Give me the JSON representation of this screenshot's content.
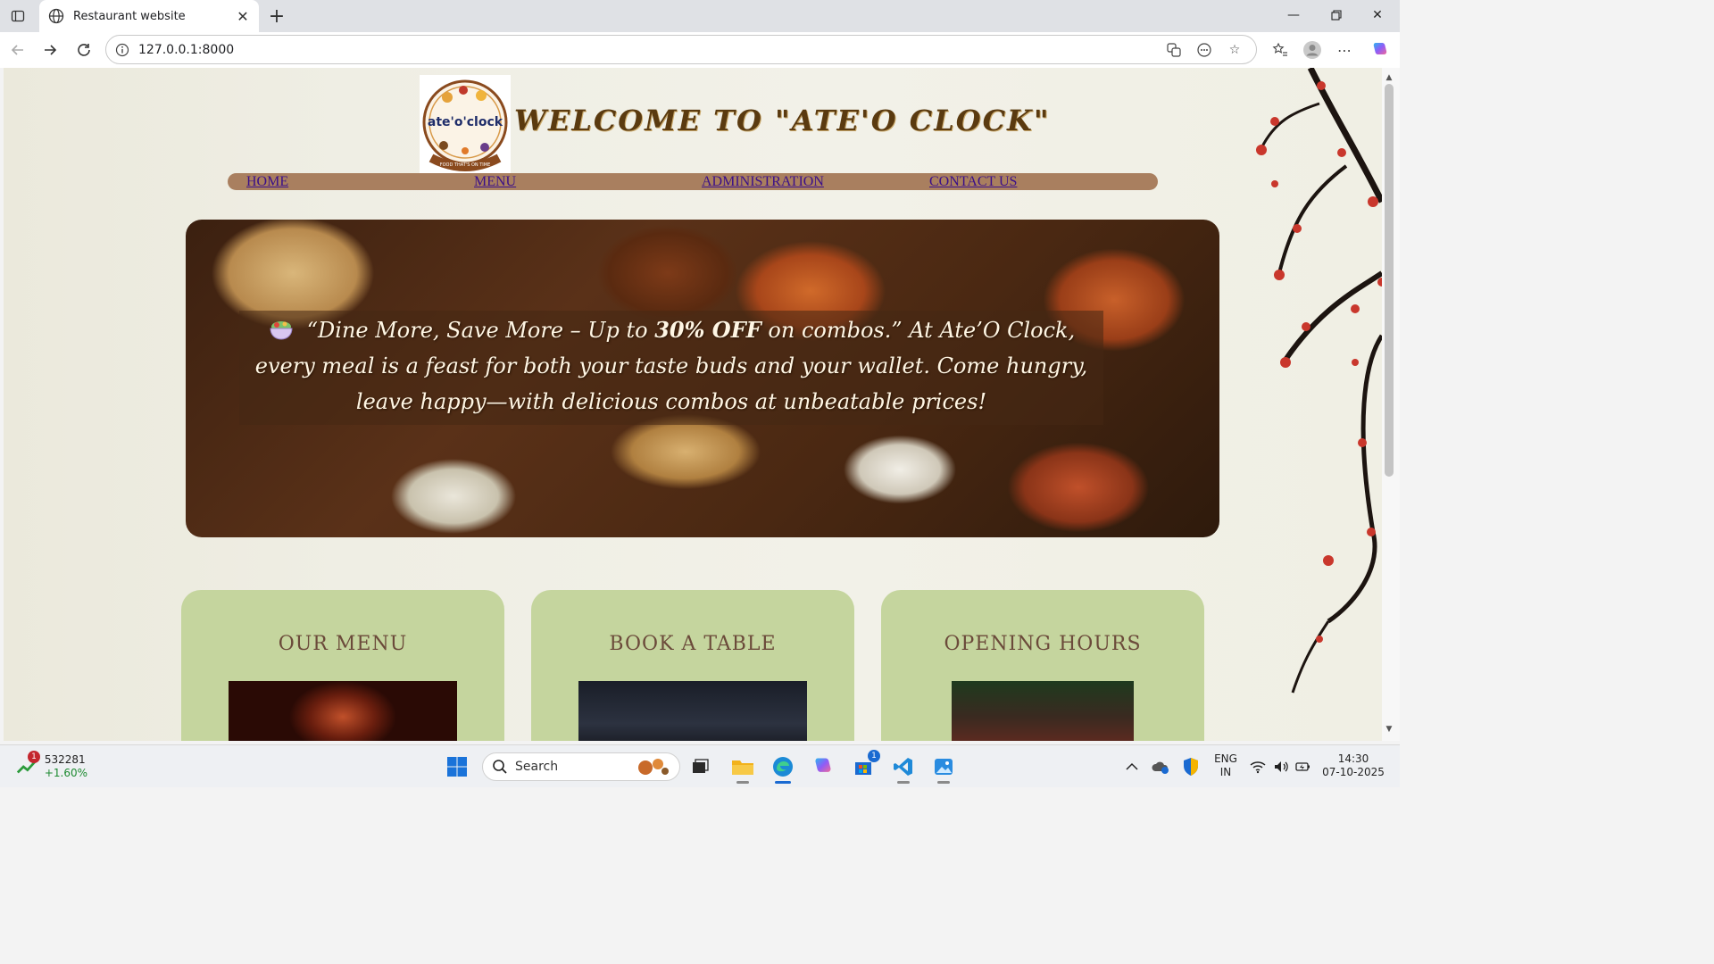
{
  "browser": {
    "tab_title": "Restaurant website",
    "url": "127.0.0.1:8000"
  },
  "page": {
    "headline": "WELCOME TO \"ATE'O CLOCK\"",
    "logo": {
      "name": "ate'o'clock",
      "tagline": "FOOD THAT'S ON TIME"
    },
    "nav": [
      {
        "label": "HOME"
      },
      {
        "label": "MENU"
      },
      {
        "label": "ADMINISTRATION"
      },
      {
        "label": "CONTACT US"
      }
    ],
    "hero": {
      "icon": "salad-bowl-icon",
      "text_part1": "“Dine More, Save More – Up to ",
      "text_bold": "30% OFF",
      "text_part2": " on combos.” At Ate’O Clock, every meal is a feast for both your taste buds and your wallet. Come hungry, leave happy—with delicious combos at unbeatable prices!"
    },
    "cards": [
      {
        "title": "OUR MENU"
      },
      {
        "title": "BOOK A TABLE"
      },
      {
        "title": "OPENING HOURS"
      }
    ]
  },
  "taskbar": {
    "stock_value": "532281",
    "stock_change": "+1.60%",
    "stock_badge": "1",
    "search_label": "Search",
    "store_badge": "1",
    "lang_line1": "ENG",
    "lang_line2": "IN",
    "time": "14:30",
    "date": "07-10-2025"
  },
  "colors": {
    "card_bg": "#c5d59e",
    "nav_bar": "#a97f5f",
    "nav_link": "#3a0f8a",
    "headline": "#5a3a10"
  }
}
